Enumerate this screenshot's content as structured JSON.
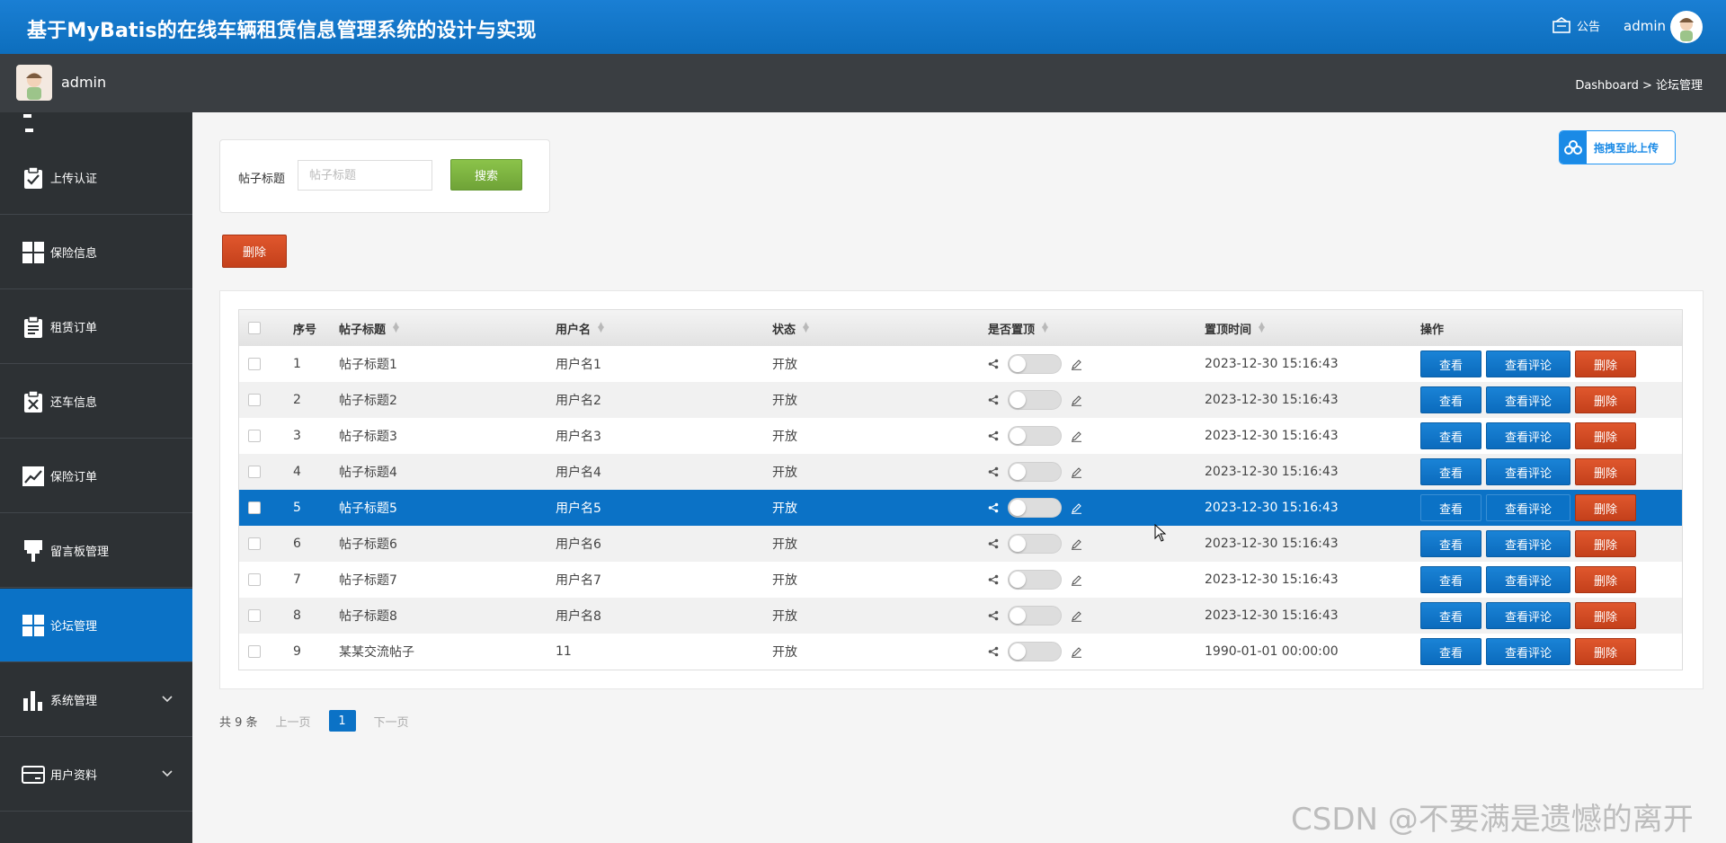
{
  "header": {
    "app_title": "基于MyBatis的在线车辆租赁信息管理系统的设计与实现",
    "notice_label": "公告",
    "admin_name": "admin"
  },
  "subheader": {
    "user_name": "admin",
    "breadcrumb": "Dashboard > 论坛管理"
  },
  "sidebar": {
    "items": [
      {
        "label": "上传认证",
        "icon": "clipboard-check-icon"
      },
      {
        "label": "保险信息",
        "icon": "grid-icon"
      },
      {
        "label": "租赁订单",
        "icon": "clipboard-list-icon"
      },
      {
        "label": "还车信息",
        "icon": "clipboard-x-icon"
      },
      {
        "label": "保险订单",
        "icon": "line-chart-icon"
      },
      {
        "label": "留言板管理",
        "icon": "pin-icon"
      },
      {
        "label": "论坛管理",
        "icon": "grid-icon"
      },
      {
        "label": "系统管理",
        "icon": "bar-chart-icon"
      },
      {
        "label": "用户资料",
        "icon": "card-icon"
      }
    ]
  },
  "search": {
    "label": "帖子标题",
    "placeholder": "帖子标题",
    "button": "搜索"
  },
  "upload_badge": "拖拽至此上传",
  "batch_delete": "删除",
  "table": {
    "headers": {
      "no": "序号",
      "title": "帖子标题",
      "user": "用户名",
      "state": "状态",
      "top": "是否置顶",
      "time": "置顶时间",
      "ops": "操作"
    },
    "rows": [
      {
        "no": "1",
        "title": "帖子标题1",
        "user": "用户名1",
        "state": "开放",
        "time": "2023-12-30 15:16:43"
      },
      {
        "no": "2",
        "title": "帖子标题2",
        "user": "用户名2",
        "state": "开放",
        "time": "2023-12-30 15:16:43"
      },
      {
        "no": "3",
        "title": "帖子标题3",
        "user": "用户名3",
        "state": "开放",
        "time": "2023-12-30 15:16:43"
      },
      {
        "no": "4",
        "title": "帖子标题4",
        "user": "用户名4",
        "state": "开放",
        "time": "2023-12-30 15:16:43"
      },
      {
        "no": "5",
        "title": "帖子标题5",
        "user": "用户名5",
        "state": "开放",
        "time": "2023-12-30 15:16:43"
      },
      {
        "no": "6",
        "title": "帖子标题6",
        "user": "用户名6",
        "state": "开放",
        "time": "2023-12-30 15:16:43"
      },
      {
        "no": "7",
        "title": "帖子标题7",
        "user": "用户名7",
        "state": "开放",
        "time": "2023-12-30 15:16:43"
      },
      {
        "no": "8",
        "title": "帖子标题8",
        "user": "用户名8",
        "state": "开放",
        "time": "2023-12-30 15:16:43"
      },
      {
        "no": "9",
        "title": "某某交流帖子",
        "user": "11",
        "state": "开放",
        "time": "1990-01-01 00:00:00"
      }
    ],
    "ops": {
      "view": "查看",
      "comment": "查看评论",
      "delete": "删除"
    }
  },
  "pager": {
    "total": "共 9 条",
    "prev": "上一页",
    "current": "1",
    "next": "下一页"
  },
  "watermark": "CSDN @不要满是遗憾的离开",
  "colors": {
    "primary": "#0b72c6",
    "danger": "#c4401b",
    "success": "#6fa337",
    "sidebar": "#2d3134"
  }
}
